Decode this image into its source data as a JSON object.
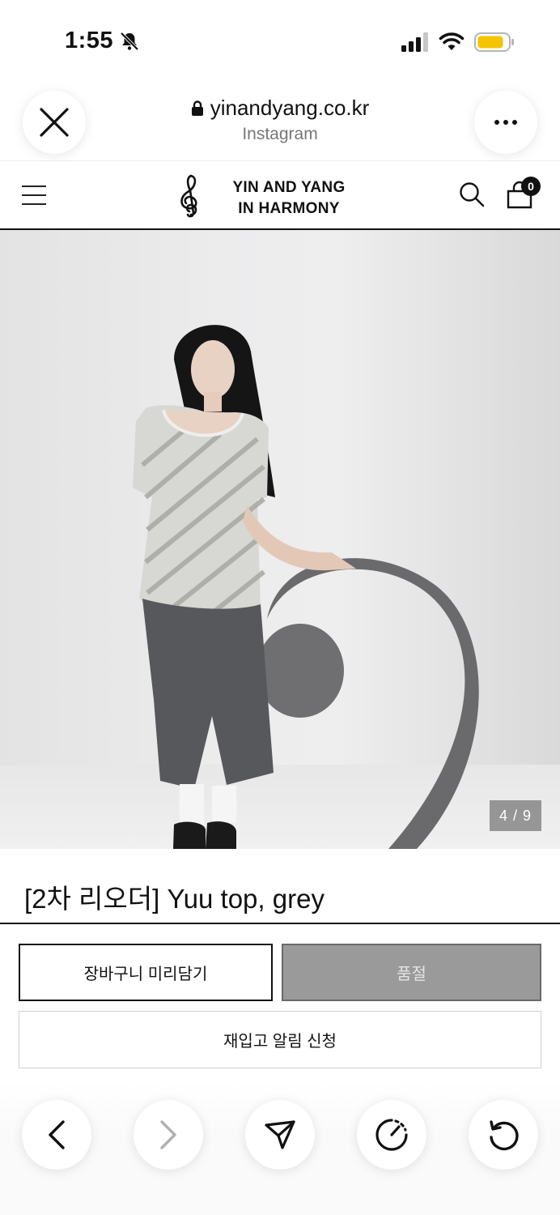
{
  "status_bar": {
    "time": "1:55",
    "icons": [
      "bell-slash-icon",
      "signal-icon",
      "wifi-icon",
      "battery-icon"
    ],
    "battery_color": "#f5c400"
  },
  "browser": {
    "url": "yinandyang.co.kr",
    "source": "Instagram",
    "close_icon": "close-icon",
    "more_icon": "more-icon"
  },
  "site_nav": {
    "brand_line1": "YIN AND YANG",
    "brand_line2": "IN HARMONY",
    "cart_count": "0"
  },
  "product": {
    "image_counter": "4 / 9",
    "title": "[2차 리오더] Yuu top, grey",
    "add_to_cart_label": "장바구니 미리담기",
    "soldout_label": "품절",
    "restock_label": "재입고 알림 신청"
  },
  "toolbar": {
    "items": [
      "back-icon",
      "forward-icon",
      "share-icon",
      "speed-icon",
      "reload-icon"
    ]
  },
  "colors": {
    "text": "#111111",
    "soldout_bg": "#9a9a9a",
    "muted": "#777777"
  }
}
